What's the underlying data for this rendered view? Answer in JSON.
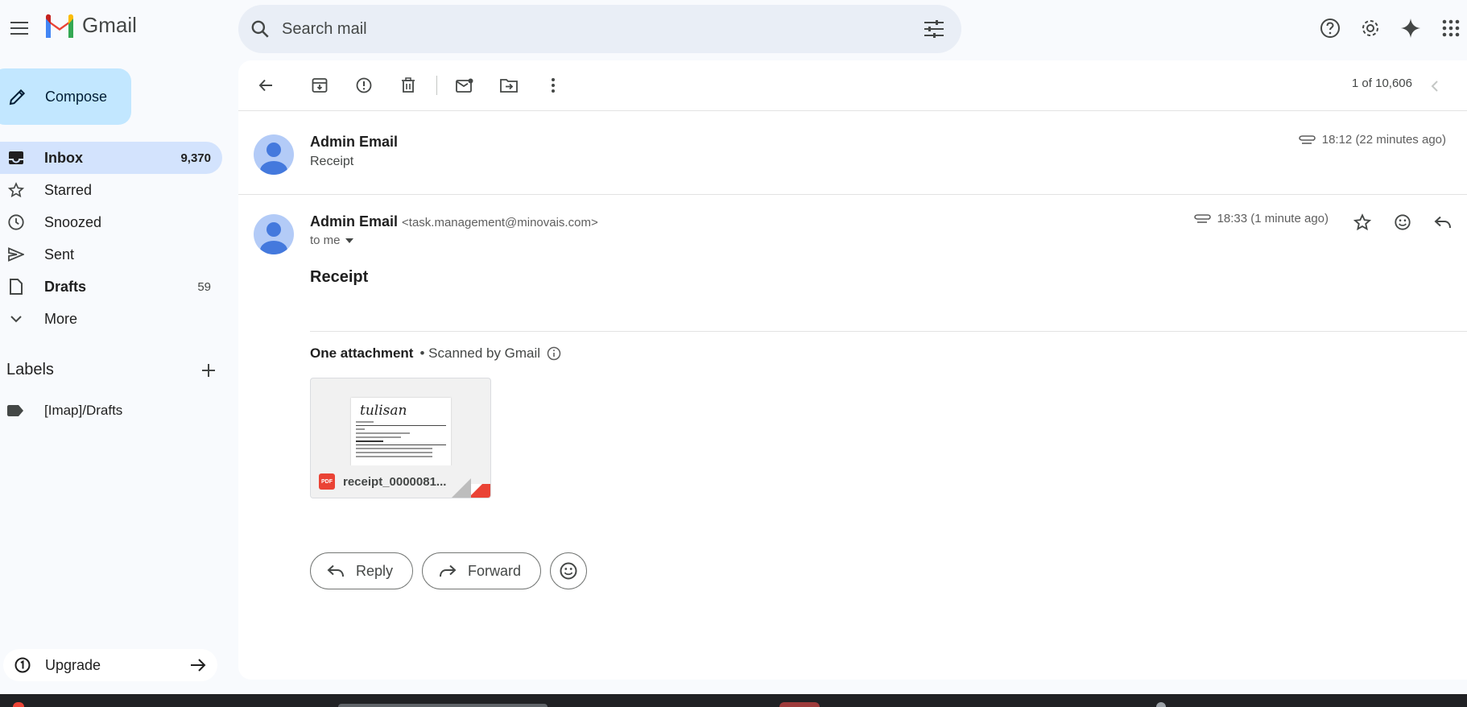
{
  "header": {
    "app_name": "Gmail",
    "search_placeholder": "Search mail"
  },
  "sidebar": {
    "compose_label": "Compose",
    "items": [
      {
        "label": "Inbox",
        "count": "9,370",
        "icon": "inbox-icon"
      },
      {
        "label": "Starred",
        "count": "",
        "icon": "star-icon"
      },
      {
        "label": "Snoozed",
        "count": "",
        "icon": "clock-icon"
      },
      {
        "label": "Sent",
        "count": "",
        "icon": "send-icon"
      },
      {
        "label": "Drafts",
        "count": "59",
        "icon": "draft-icon"
      },
      {
        "label": "More",
        "count": "",
        "icon": "chevron-down-icon"
      }
    ],
    "labels_title": "Labels",
    "labels": [
      {
        "label": "[Imap]/Drafts",
        "icon": "label-icon"
      }
    ],
    "upgrade_label": "Upgrade"
  },
  "toolbar": {
    "pager_text": "1 of 10,606"
  },
  "thread": {
    "messages": [
      {
        "sender": "Admin Email",
        "snippet": "Receipt",
        "time": "18:12 (22 minutes ago)"
      },
      {
        "sender": "Admin Email",
        "email": "<task.management@minovais.com>",
        "to": "to me",
        "time": "18:33 (1 minute ago)"
      }
    ],
    "subject": "Receipt",
    "attachments_title": "One attachment",
    "attachments_scan": "• Scanned by Gmail",
    "attachment": {
      "filename": "receipt_0000081...",
      "type_badge": "PDF",
      "preview_brand": "tulisan"
    },
    "reply_label": "Reply",
    "forward_label": "Forward"
  },
  "colors": {
    "accent": "#c2e7ff",
    "active_nav": "#d3e3fd",
    "pdf_red": "#ea4335",
    "avatar_bg": "#b3cbf7",
    "avatar_fg": "#4479dd"
  }
}
